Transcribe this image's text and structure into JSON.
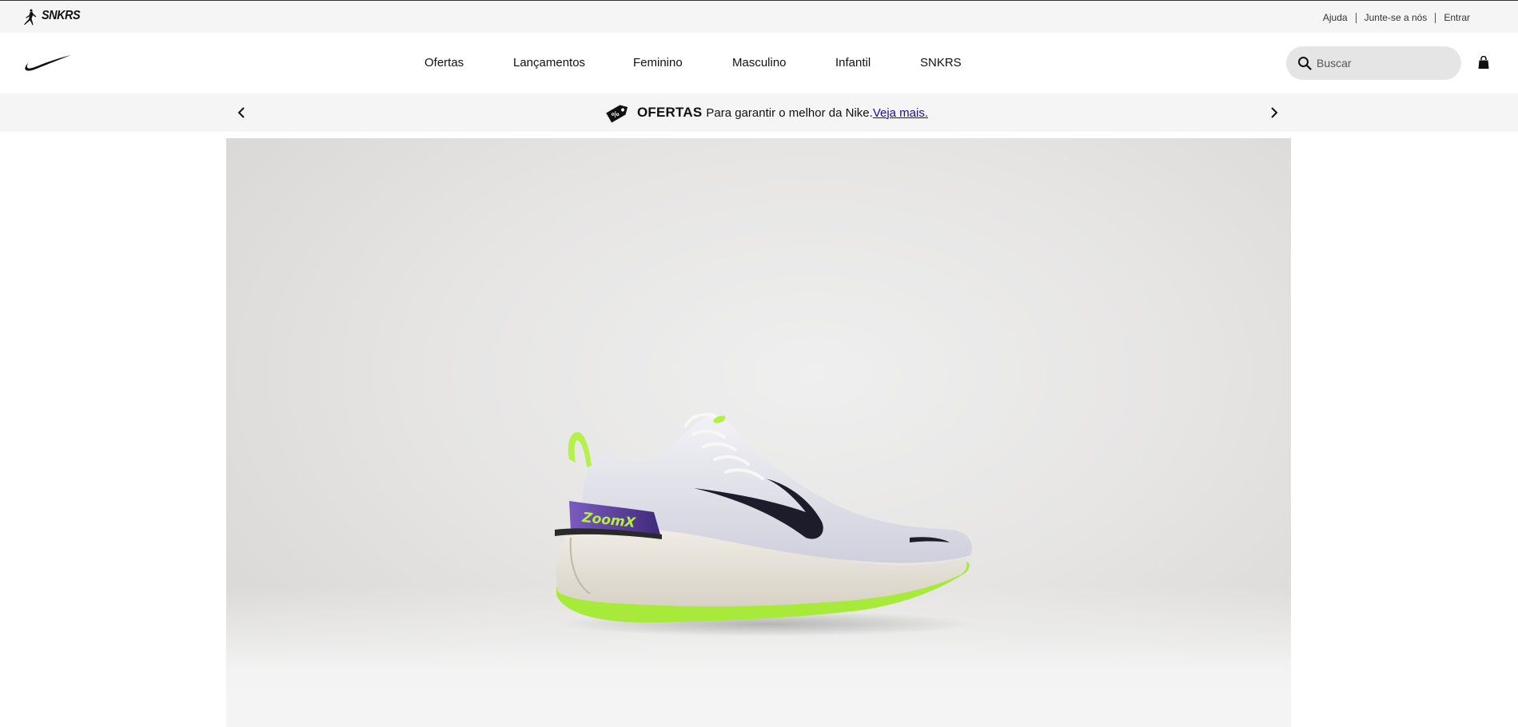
{
  "utility_bar": {
    "brand_jordan_icon": "jumpman-icon",
    "brand_snkrs": "SNKRS",
    "links": [
      "Ajuda",
      "Junte-se a nós",
      "Entrar"
    ]
  },
  "header": {
    "logo_icon": "nike-swoosh-icon",
    "nav": [
      "Ofertas",
      "Lançamentos",
      "Feminino",
      "Masculino",
      "Infantil",
      "SNKRS"
    ],
    "search": {
      "placeholder": "Buscar",
      "value": ""
    },
    "bag_icon": "shopping-bag-icon"
  },
  "promo": {
    "icon": "price-tag-icon",
    "title": "OFERTAS",
    "text": "Para garantir o melhor da Nike.",
    "link": "Veja mais."
  },
  "hero": {
    "image": "running-shoe-zoomx",
    "shoe_print": "ZoomX"
  },
  "colors": {
    "utility_bg": "#f5f5f5",
    "search_bg": "#e5e5e5",
    "link": "#1a0dab",
    "volt": "#b7f03c",
    "purple": "#5a3a9a"
  }
}
